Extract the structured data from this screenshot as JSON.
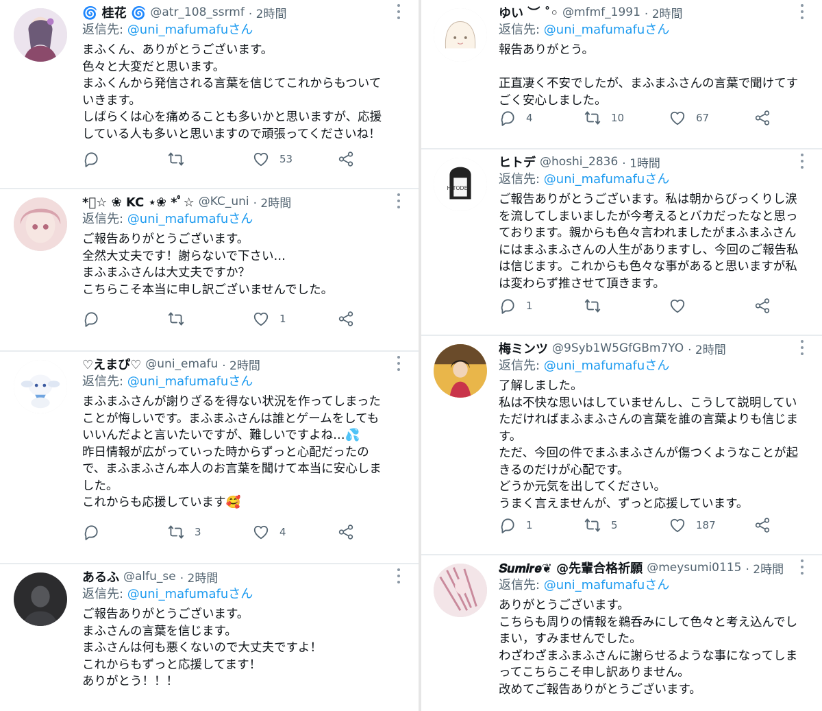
{
  "tweets_left": [
    {
      "name": "🌀 桂花 🌀",
      "handle": "@atr_108_ssrmf",
      "time": "· 2時間",
      "reply_prefix": "返信先: ",
      "reply_to": "@uni_mafumafuさん",
      "lines": [
        "まふくん、ありがとうございます。",
        "色々と大変だと思います。",
        "まふくんから発信される言葉を信じてこれからもついて",
        "いきます。",
        "しばらくは心を痛めることも多いかと思いますが、応援",
        "している人も多いと思いますので頑張ってくださいね！"
      ],
      "counts": {
        "reply": "",
        "retweet": "",
        "like": "53"
      }
    },
    {
      "name": "*ﾟ☆ ❀ KC ⋆❀ *ﾟ☆",
      "handle": "@KC_uni",
      "time": "· 2時間",
      "reply_prefix": "返信先: ",
      "reply_to": "@uni_mafumafuさん",
      "lines": [
        "ご報告ありがとうございます。",
        "全然大丈夫です！謝らないで下さい…",
        "まふまふさんは大丈夫ですか？",
        "こちらこそ本当に申し訳ございませんでした。"
      ],
      "counts": {
        "reply": "",
        "retweet": "",
        "like": "1"
      }
    },
    {
      "name": "♡えまぴ♡",
      "handle": "@uni_emafu",
      "time": "· 2時間",
      "reply_prefix": "返信先: ",
      "reply_to": "@uni_mafumafuさん",
      "lines": [
        "まふまふさんが謝りざるを得ない状況を作ってしまった",
        "ことが悔しいです。まふまふさんは誰とゲームをしても",
        "いいんだよと言いたいですが、難しいですよね…💦",
        "昨日情報が広がっていった時からずっと心配だったの",
        "で、まふまふさん本人のお言葉を聞けて本当に安心しま",
        "した。",
        "これからも応援しています🥰"
      ],
      "counts": {
        "reply": "",
        "retweet": "3",
        "like": "4"
      }
    },
    {
      "name": "あるふ",
      "handle": "@alfu_se",
      "time": "· 2時間",
      "reply_prefix": "返信先: ",
      "reply_to": "@uni_mafumafuさん",
      "lines": [
        "ご報告ありがとうございます。",
        "まふさんの言葉を信じます。",
        "まふさんは何も悪くないので大丈夫ですよ！",
        "これからもずっと応援してます！",
        "ありがとう！！！"
      ],
      "counts": null
    }
  ],
  "tweets_right": [
    {
      "name": "ゆい ︶ ˚◦",
      "handle": "@mfmf_1991",
      "time": "· 2時間",
      "reply_prefix": "返信先: ",
      "reply_to": "@uni_mafumafuさん",
      "lines": [
        "報告ありがとう。",
        "",
        "正直凄く不安でしたが、まふまふさんの言葉で聞けてす",
        "ごく安心しました。"
      ],
      "counts": {
        "reply": "4",
        "retweet": "10",
        "like": "67"
      }
    },
    {
      "name": "ヒトデ",
      "handle": "@hoshi_2836",
      "time": "· 1時間",
      "reply_prefix": "返信先: ",
      "reply_to": "@uni_mafumafuさん",
      "lines": [
        "ご報告ありがとうございます。私は朝からびっくりし涙",
        "を流してしまいましたが今考えるとバカだったなと思っ",
        "ております。親からも色々言われましたがまふまふさん",
        "にはまふまふさんの人生がありますし、今回のご報告私",
        "は信じます。これからも色々な事があると思いますが私",
        "は変わらず推させて頂きます。"
      ],
      "counts": {
        "reply": "1",
        "retweet": "",
        "like": ""
      }
    },
    {
      "name": "梅ミンツ",
      "handle": "@9Syb1W5GfGBm7YO",
      "time": "· 2時間",
      "reply_prefix": "返信先: ",
      "reply_to": "@uni_mafumafuさん",
      "lines": [
        "了解しました。",
        "私は不快な思いはしていませんし、こうして説明してい",
        "ただければまふまふさんの言葉を誰の言葉よりも信じま",
        "す。",
        "ただ、今回の件でまふまふさんが傷つくようなことが起",
        "きるのだけが心配です。",
        "どうか元気を出してください。",
        "うまく言えませんが、ずっと応援しています。"
      ],
      "counts": {
        "reply": "1",
        "retweet": "5",
        "like": "187"
      }
    },
    {
      "name": "𝑺𝒖𝒎𝒊𝒓𝒆❦ @先輩合格祈願",
      "handle": "@meysumi0115",
      "time": "· 2時間",
      "reply_prefix": "返信先: ",
      "reply_to": "@uni_mafumafuさん",
      "lines": [
        "ありがとうございます。",
        "こちらも周りの情報を鵜呑みにして色々と考え込んでし",
        "まい，すみませんでした。",
        "わざわざまふまふさんに謝らせるような事になってしま",
        "ってこちらこそ申し訳ありません。",
        "改めてご報告ありがとうございます。"
      ],
      "counts": null
    }
  ],
  "icons": {
    "reply": "reply-icon",
    "retweet": "retweet-icon",
    "like": "like-icon",
    "share": "share-icon",
    "more": "more-icon"
  },
  "colors": {
    "link": "#1d9bf0",
    "muted": "#536471",
    "divider": "#e6e6e6"
  }
}
